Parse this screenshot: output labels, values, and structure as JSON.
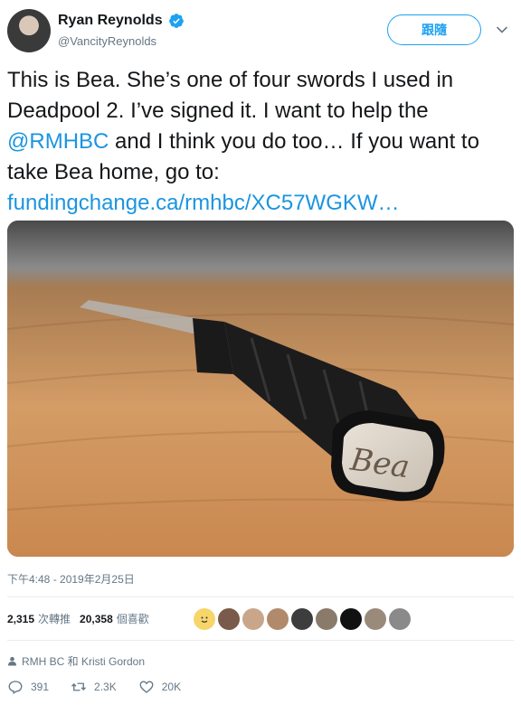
{
  "user": {
    "name": "Ryan Reynolds",
    "handle": "@VancityReynolds",
    "follow_label": "跟隨"
  },
  "tweet": {
    "text_part1": "This is Bea. She’s one of four swords I used in Deadpool 2. I’ve signed it. I want to help the ",
    "mention": "@RMHBC",
    "text_part2": " and I think you do too… If you want to take Bea home, go to:",
    "link": "fundingchange.ca/rmhbc/XC57WGKW…",
    "image_inscription": "Bea"
  },
  "timestamp": "下午4:48 - 2019年2月25日",
  "stats": {
    "retweets_count": "2,315",
    "retweets_label": "次轉推",
    "likes_count": "20,358",
    "likes_label": "個喜歡"
  },
  "context": {
    "text": "RMH BC 和 Kristi Gordon"
  },
  "actions": {
    "reply_count": "391",
    "retweet_count": "2.3K",
    "like_count": "20K"
  },
  "colors": {
    "accent": "#1da1f2",
    "link": "#1b95e0",
    "secondary_text": "#657786",
    "divider": "#e6ecf0"
  },
  "liker_avatars": [
    {
      "color": "#f2d16b"
    },
    {
      "color": "#7a5a4a"
    },
    {
      "color": "#c9a68a"
    },
    {
      "color": "#b08a6a"
    },
    {
      "color": "#3d3d3d"
    },
    {
      "color": "#8a7a6a"
    },
    {
      "color": "#111111"
    },
    {
      "color": "#9a8a7a"
    },
    {
      "color": "#8a8a8a"
    }
  ]
}
